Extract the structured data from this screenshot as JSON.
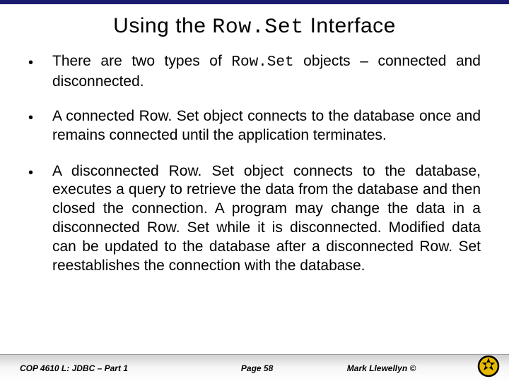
{
  "title": {
    "prefix": "Using the ",
    "mono": "Row.Set",
    "suffix": " Interface"
  },
  "bullets": [
    {
      "t0": "There are two types of ",
      "mono": "Row.Set",
      "t1": " objects – connected and disconnected."
    },
    {
      "t0": "A connected Row. Set object connects to the database once and remains connected until the application terminates.",
      "mono": "",
      "t1": ""
    },
    {
      "t0": "A disconnected Row. Set object connects to the database, executes a query to retrieve the data from the database and then closed the connection.  A program may change the data in a disconnected Row. Set while it is disconnected.  Modified data can be updated to the database after a disconnected Row. Set reestablishes the connection with the database.",
      "mono": "",
      "t1": ""
    }
  ],
  "footer": {
    "left": "COP 4610 L: JDBC – Part 1",
    "center": "Page 58",
    "right": "Mark Llewellyn ©"
  }
}
